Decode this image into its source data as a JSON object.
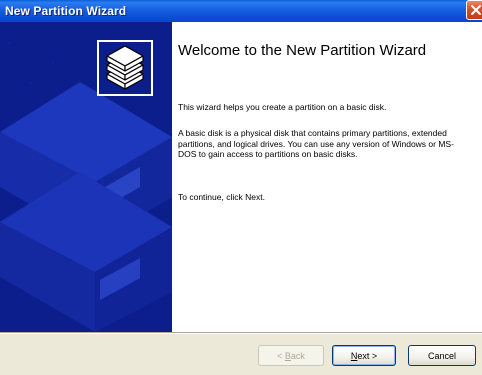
{
  "window": {
    "title": "New Partition Wizard",
    "close_icon": "close-icon"
  },
  "side_panel": {
    "logo_icon": "stacked-disks-icon",
    "background_color": "#0c1d8c"
  },
  "content": {
    "heading": "Welcome to the New Partition Wizard",
    "paragraph_1": "This wizard helps you create a partition on a basic disk.",
    "paragraph_2": "A basic disk is a physical disk that contains primary partitions, extended partitions, and logical drives. You can use any version of Windows or MS-DOS to gain access to partitions on basic disks.",
    "paragraph_3": "To continue, click Next."
  },
  "buttons": {
    "back": {
      "pre": "< ",
      "key": "B",
      "post": "ack",
      "enabled": false
    },
    "next": {
      "pre": "",
      "key": "N",
      "post": "ext >",
      "enabled": true
    },
    "cancel": {
      "label": "Cancel",
      "enabled": true
    }
  }
}
